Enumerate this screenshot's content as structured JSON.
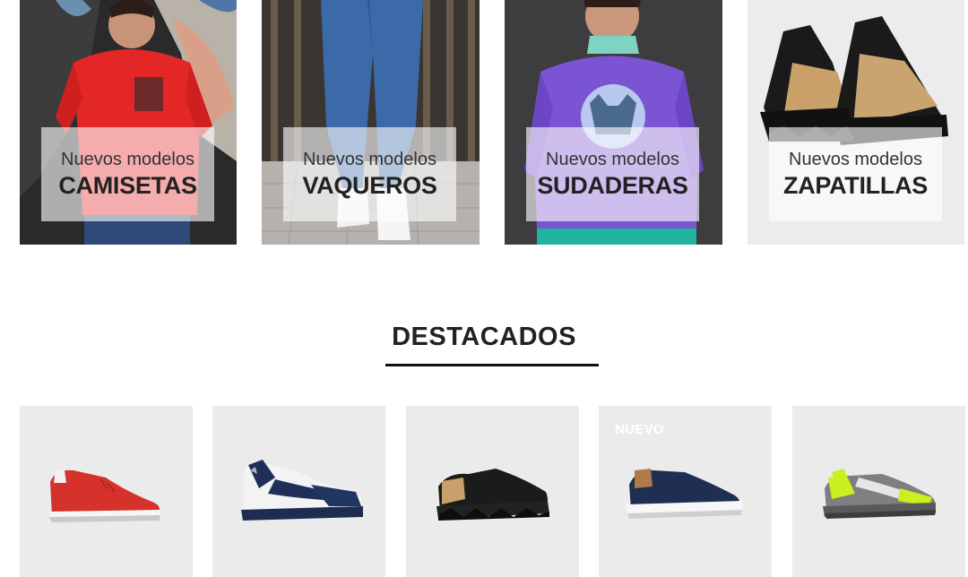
{
  "categories": [
    {
      "subtitle": "Nuevos modelos",
      "title": "CAMISETAS"
    },
    {
      "subtitle": "Nuevos modelos",
      "title": "VAQUEROS"
    },
    {
      "subtitle": "Nuevos modelos",
      "title": "SUDADERAS"
    },
    {
      "subtitle": "Nuevos modelos",
      "title": "ZAPATILLAS"
    }
  ],
  "featured": {
    "title": "DESTACADOS",
    "products": [
      {
        "badge": "",
        "image": "red-sneaker"
      },
      {
        "badge": "",
        "image": "navy-white-sneaker"
      },
      {
        "badge": "",
        "image": "black-tan-sneaker"
      },
      {
        "badge": "NUEVO",
        "image": "navy-sneaker"
      },
      {
        "badge": "",
        "image": "grey-neon-sneaker"
      }
    ]
  },
  "colors": {
    "accent": "#111111",
    "card_bg": "#ebebeb"
  }
}
